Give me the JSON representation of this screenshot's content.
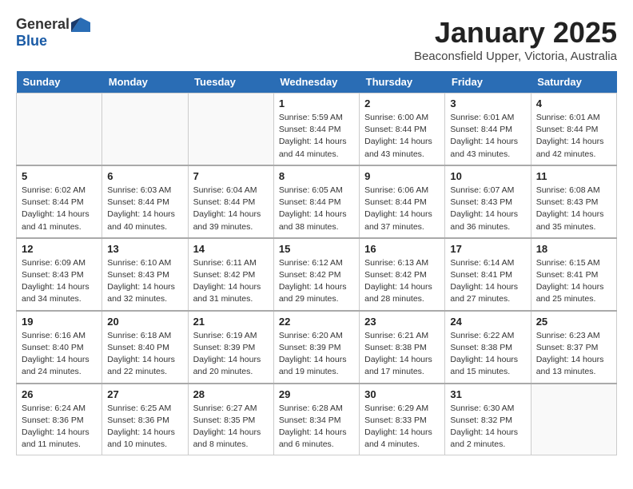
{
  "logo": {
    "general": "General",
    "blue": "Blue"
  },
  "title": "January 2025",
  "location": "Beaconsfield Upper, Victoria, Australia",
  "weekdays": [
    "Sunday",
    "Monday",
    "Tuesday",
    "Wednesday",
    "Thursday",
    "Friday",
    "Saturday"
  ],
  "weeks": [
    [
      {
        "day": "",
        "info": ""
      },
      {
        "day": "",
        "info": ""
      },
      {
        "day": "",
        "info": ""
      },
      {
        "day": "1",
        "info": "Sunrise: 5:59 AM\nSunset: 8:44 PM\nDaylight: 14 hours\nand 44 minutes."
      },
      {
        "day": "2",
        "info": "Sunrise: 6:00 AM\nSunset: 8:44 PM\nDaylight: 14 hours\nand 43 minutes."
      },
      {
        "day": "3",
        "info": "Sunrise: 6:01 AM\nSunset: 8:44 PM\nDaylight: 14 hours\nand 43 minutes."
      },
      {
        "day": "4",
        "info": "Sunrise: 6:01 AM\nSunset: 8:44 PM\nDaylight: 14 hours\nand 42 minutes."
      }
    ],
    [
      {
        "day": "5",
        "info": "Sunrise: 6:02 AM\nSunset: 8:44 PM\nDaylight: 14 hours\nand 41 minutes."
      },
      {
        "day": "6",
        "info": "Sunrise: 6:03 AM\nSunset: 8:44 PM\nDaylight: 14 hours\nand 40 minutes."
      },
      {
        "day": "7",
        "info": "Sunrise: 6:04 AM\nSunset: 8:44 PM\nDaylight: 14 hours\nand 39 minutes."
      },
      {
        "day": "8",
        "info": "Sunrise: 6:05 AM\nSunset: 8:44 PM\nDaylight: 14 hours\nand 38 minutes."
      },
      {
        "day": "9",
        "info": "Sunrise: 6:06 AM\nSunset: 8:44 PM\nDaylight: 14 hours\nand 37 minutes."
      },
      {
        "day": "10",
        "info": "Sunrise: 6:07 AM\nSunset: 8:43 PM\nDaylight: 14 hours\nand 36 minutes."
      },
      {
        "day": "11",
        "info": "Sunrise: 6:08 AM\nSunset: 8:43 PM\nDaylight: 14 hours\nand 35 minutes."
      }
    ],
    [
      {
        "day": "12",
        "info": "Sunrise: 6:09 AM\nSunset: 8:43 PM\nDaylight: 14 hours\nand 34 minutes."
      },
      {
        "day": "13",
        "info": "Sunrise: 6:10 AM\nSunset: 8:43 PM\nDaylight: 14 hours\nand 32 minutes."
      },
      {
        "day": "14",
        "info": "Sunrise: 6:11 AM\nSunset: 8:42 PM\nDaylight: 14 hours\nand 31 minutes."
      },
      {
        "day": "15",
        "info": "Sunrise: 6:12 AM\nSunset: 8:42 PM\nDaylight: 14 hours\nand 29 minutes."
      },
      {
        "day": "16",
        "info": "Sunrise: 6:13 AM\nSunset: 8:42 PM\nDaylight: 14 hours\nand 28 minutes."
      },
      {
        "day": "17",
        "info": "Sunrise: 6:14 AM\nSunset: 8:41 PM\nDaylight: 14 hours\nand 27 minutes."
      },
      {
        "day": "18",
        "info": "Sunrise: 6:15 AM\nSunset: 8:41 PM\nDaylight: 14 hours\nand 25 minutes."
      }
    ],
    [
      {
        "day": "19",
        "info": "Sunrise: 6:16 AM\nSunset: 8:40 PM\nDaylight: 14 hours\nand 24 minutes."
      },
      {
        "day": "20",
        "info": "Sunrise: 6:18 AM\nSunset: 8:40 PM\nDaylight: 14 hours\nand 22 minutes."
      },
      {
        "day": "21",
        "info": "Sunrise: 6:19 AM\nSunset: 8:39 PM\nDaylight: 14 hours\nand 20 minutes."
      },
      {
        "day": "22",
        "info": "Sunrise: 6:20 AM\nSunset: 8:39 PM\nDaylight: 14 hours\nand 19 minutes."
      },
      {
        "day": "23",
        "info": "Sunrise: 6:21 AM\nSunset: 8:38 PM\nDaylight: 14 hours\nand 17 minutes."
      },
      {
        "day": "24",
        "info": "Sunrise: 6:22 AM\nSunset: 8:38 PM\nDaylight: 14 hours\nand 15 minutes."
      },
      {
        "day": "25",
        "info": "Sunrise: 6:23 AM\nSunset: 8:37 PM\nDaylight: 14 hours\nand 13 minutes."
      }
    ],
    [
      {
        "day": "26",
        "info": "Sunrise: 6:24 AM\nSunset: 8:36 PM\nDaylight: 14 hours\nand 11 minutes."
      },
      {
        "day": "27",
        "info": "Sunrise: 6:25 AM\nSunset: 8:36 PM\nDaylight: 14 hours\nand 10 minutes."
      },
      {
        "day": "28",
        "info": "Sunrise: 6:27 AM\nSunset: 8:35 PM\nDaylight: 14 hours\nand 8 minutes."
      },
      {
        "day": "29",
        "info": "Sunrise: 6:28 AM\nSunset: 8:34 PM\nDaylight: 14 hours\nand 6 minutes."
      },
      {
        "day": "30",
        "info": "Sunrise: 6:29 AM\nSunset: 8:33 PM\nDaylight: 14 hours\nand 4 minutes."
      },
      {
        "day": "31",
        "info": "Sunrise: 6:30 AM\nSunset: 8:32 PM\nDaylight: 14 hours\nand 2 minutes."
      },
      {
        "day": "",
        "info": ""
      }
    ]
  ]
}
